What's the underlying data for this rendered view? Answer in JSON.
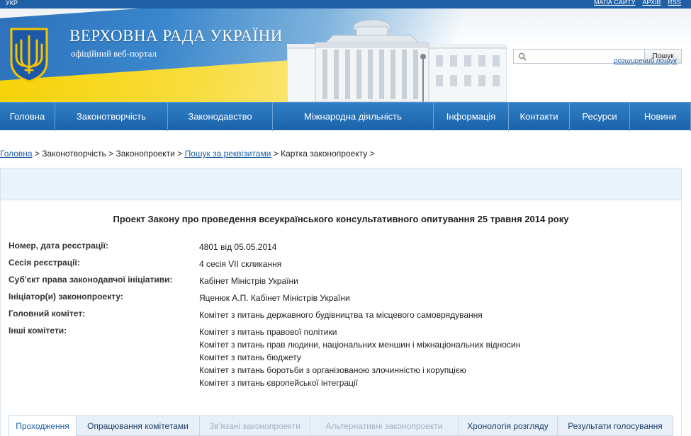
{
  "topbar": {
    "lang": "УКР",
    "links": [
      "МАПА САЙТУ",
      "АРХІВ",
      "RSS"
    ]
  },
  "header": {
    "title": "ВЕРХОВНА РАДА УКРАЇНИ",
    "subtitle": "офіційний веб-портал",
    "search_button": "Пошук",
    "search_placeholder": "",
    "advanced_search": "розширений пошук"
  },
  "nav": [
    {
      "label": "Головна",
      "width": 78
    },
    {
      "label": "Законотворчість",
      "width": 159
    },
    {
      "label": "Законодавство",
      "width": 148
    },
    {
      "label": "Міжнародна діяльність",
      "width": 227
    },
    {
      "label": "Інформація",
      "width": 106
    },
    {
      "label": "Контакти",
      "width": 86
    },
    {
      "label": "Ресурси",
      "width": 85
    },
    {
      "label": "Новини",
      "width": 86
    }
  ],
  "breadcrumb": [
    {
      "label": "Головна",
      "link": true
    },
    {
      "label": "Законотворчість",
      "link": false
    },
    {
      "label": "Законопроекти",
      "link": false
    },
    {
      "label": "Пошук за реквізитами",
      "link": true
    },
    {
      "label": "Картка законопроекту",
      "link": false
    }
  ],
  "bill": {
    "title": "Проект Закону про проведення всеукраїнського консультативного опитування 25 травня 2014 року",
    "fields": [
      {
        "label": "Номер, дата реєстрації:",
        "values": [
          "4801 від 05.05.2014"
        ]
      },
      {
        "label": "Сесія реєстрації:",
        "values": [
          "4 сесія VII скликання"
        ]
      },
      {
        "label": "Суб'єкт права законодавчої ініціативи:",
        "values": [
          "Кабінет Міністрів України"
        ]
      },
      {
        "label": "Ініціатор(и) законопроекту:",
        "values": [
          "Яценюк А.П. Кабінет Міністрів України"
        ]
      },
      {
        "label": "Головний комітет:",
        "values": [
          "Комітет з питань державного будівництва та місцевого самоврядування"
        ]
      },
      {
        "label": "Інші комітети:",
        "values": [
          "Комітет з питань правової політики",
          "Комітет з питань прав людини, національних меншин і міжнаціональних відносин",
          "Комітет з питань бюджету",
          "Комітет з питань боротьби з організованою злочинністю і корупцією",
          "Комітет з питань європейської інтеграції"
        ]
      }
    ]
  },
  "tabs": [
    {
      "label": "Проходження",
      "state": "active",
      "width": 95
    },
    {
      "label": "Опрацювання комітетами",
      "state": "normal",
      "width": 174
    },
    {
      "label": "Зв'язані законопроекти",
      "state": "disabled",
      "width": 156
    },
    {
      "label": "Альтернативні законопроекти",
      "state": "disabled",
      "width": 209
    },
    {
      "label": "Хронологія розгляду",
      "state": "normal",
      "width": 140
    },
    {
      "label": "Результати голосування",
      "state": "normal",
      "width": 164
    }
  ]
}
